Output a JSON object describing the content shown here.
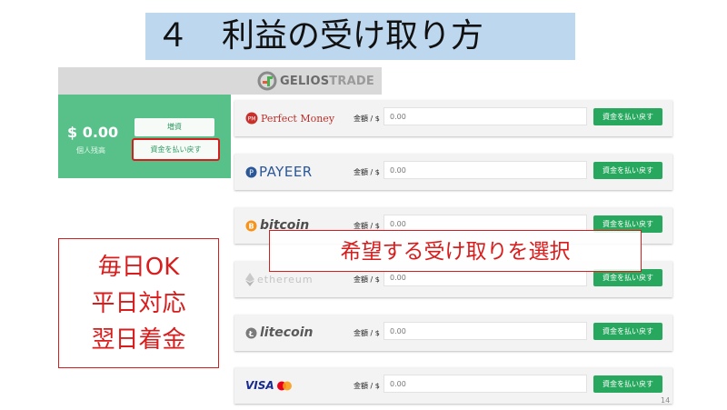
{
  "slide": {
    "title": "４　利益の受け取り方",
    "page_number": "14",
    "callout": "希望する受け取りを選択",
    "info_lines": [
      "毎日OK",
      "平日対応",
      "翌日着金"
    ],
    "accent_color": "#d91c1c"
  },
  "app": {
    "logo_g": "GELIOS",
    "logo_t": "TRADE",
    "balance": {
      "amount": "$ 0.00",
      "label": "個人残高"
    },
    "deposit_label": "増資",
    "withdraw_label": "資金を払い戻す",
    "card_color": "#58c18a"
  },
  "methods": [
    {
      "name": "Perfect Money",
      "amount_label": "金額 / $",
      "placeholder": "0.00",
      "button": "資金を払い戻す"
    },
    {
      "name": "PAYEER",
      "amount_label": "金額 / $",
      "placeholder": "0.00",
      "button": "資金を払い戻す"
    },
    {
      "name": "bitcoin",
      "amount_label": "金額 / $",
      "placeholder": "0.00",
      "button": "資金を払い戻す"
    },
    {
      "name": "ethereum",
      "amount_label": "金額 / $",
      "placeholder": "0.00",
      "button": "資金を払い戻す"
    },
    {
      "name": "litecoin",
      "amount_label": "金額 / $",
      "placeholder": "0.00",
      "button": "資金を払い戻す"
    },
    {
      "name": "VISA",
      "amount_label": "金額 / $",
      "placeholder": "0.00",
      "button": "資金を払い戻す"
    }
  ]
}
